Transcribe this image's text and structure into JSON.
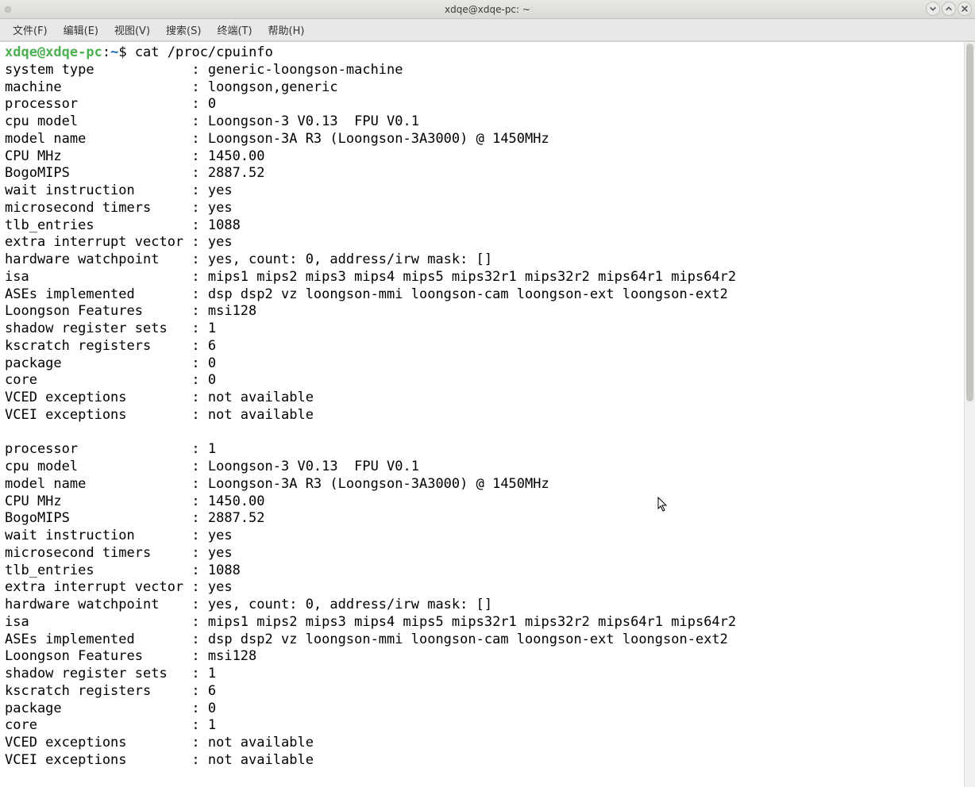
{
  "window": {
    "title": "xdqe@xdqe-pc: ~"
  },
  "menubar": [
    {
      "label": "文件(F)"
    },
    {
      "label": "编辑(E)"
    },
    {
      "label": "视图(V)"
    },
    {
      "label": "搜索(S)"
    },
    {
      "label": "终端(T)"
    },
    {
      "label": "帮助(H)"
    }
  ],
  "prompt": {
    "user": "xdqe@xdqe-pc",
    "sep": ":",
    "path": "~",
    "symbol": "$",
    "command": "cat /proc/cpuinfo"
  },
  "cpuinfo": [
    {
      "k": "system type",
      "v": "generic-loongson-machine"
    },
    {
      "k": "machine",
      "v": "loongson,generic"
    },
    {
      "k": "processor",
      "v": "0"
    },
    {
      "k": "cpu model",
      "v": "Loongson-3 V0.13  FPU V0.1"
    },
    {
      "k": "model name",
      "v": "Loongson-3A R3 (Loongson-3A3000) @ 1450MHz"
    },
    {
      "k": "CPU MHz",
      "v": "1450.00"
    },
    {
      "k": "BogoMIPS",
      "v": "2887.52"
    },
    {
      "k": "wait instruction",
      "v": "yes"
    },
    {
      "k": "microsecond timers",
      "v": "yes"
    },
    {
      "k": "tlb_entries",
      "v": "1088"
    },
    {
      "k": "extra interrupt vector",
      "v": "yes"
    },
    {
      "k": "hardware watchpoint",
      "v": "yes, count: 0, address/irw mask: []"
    },
    {
      "k": "isa",
      "v": "mips1 mips2 mips3 mips4 mips5 mips32r1 mips32r2 mips64r1 mips64r2"
    },
    {
      "k": "ASEs implemented",
      "v": "dsp dsp2 vz loongson-mmi loongson-cam loongson-ext loongson-ext2"
    },
    {
      "k": "Loongson Features",
      "v": "msi128"
    },
    {
      "k": "shadow register sets",
      "v": "1"
    },
    {
      "k": "kscratch registers",
      "v": "6"
    },
    {
      "k": "package",
      "v": "0"
    },
    {
      "k": "core",
      "v": "0"
    },
    {
      "k": "VCED exceptions",
      "v": "not available"
    },
    {
      "k": "VCEI exceptions",
      "v": "not available"
    },
    {
      "blank": true
    },
    {
      "k": "processor",
      "v": "1"
    },
    {
      "k": "cpu model",
      "v": "Loongson-3 V0.13  FPU V0.1"
    },
    {
      "k": "model name",
      "v": "Loongson-3A R3 (Loongson-3A3000) @ 1450MHz"
    },
    {
      "k": "CPU MHz",
      "v": "1450.00"
    },
    {
      "k": "BogoMIPS",
      "v": "2887.52"
    },
    {
      "k": "wait instruction",
      "v": "yes"
    },
    {
      "k": "microsecond timers",
      "v": "yes"
    },
    {
      "k": "tlb_entries",
      "v": "1088"
    },
    {
      "k": "extra interrupt vector",
      "v": "yes"
    },
    {
      "k": "hardware watchpoint",
      "v": "yes, count: 0, address/irw mask: []"
    },
    {
      "k": "isa",
      "v": "mips1 mips2 mips3 mips4 mips5 mips32r1 mips32r2 mips64r1 mips64r2"
    },
    {
      "k": "ASEs implemented",
      "v": "dsp dsp2 vz loongson-mmi loongson-cam loongson-ext loongson-ext2"
    },
    {
      "k": "Loongson Features",
      "v": "msi128"
    },
    {
      "k": "shadow register sets",
      "v": "1"
    },
    {
      "k": "kscratch registers",
      "v": "6"
    },
    {
      "k": "package",
      "v": "0"
    },
    {
      "k": "core",
      "v": "1"
    },
    {
      "k": "VCED exceptions",
      "v": "not available"
    },
    {
      "k": "VCEI exceptions",
      "v": "not available"
    }
  ]
}
